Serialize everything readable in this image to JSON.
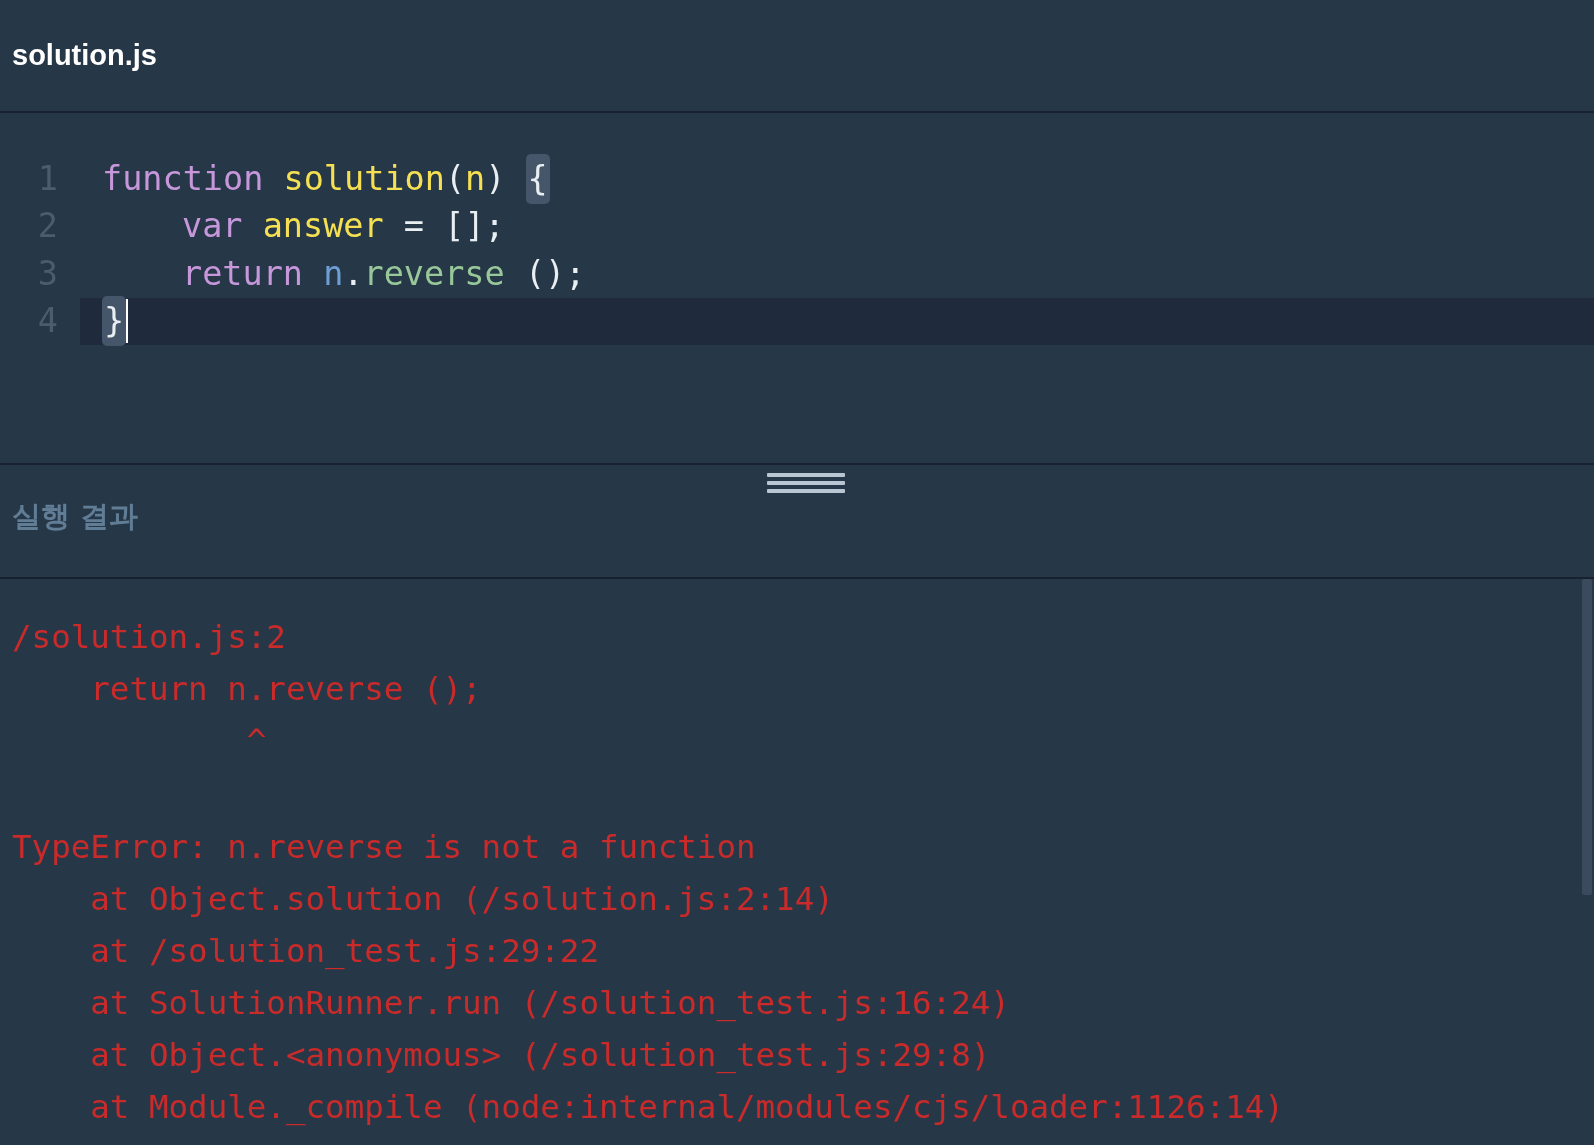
{
  "file_tab": {
    "title": "solution.js"
  },
  "editor": {
    "lines": [
      {
        "number": "1",
        "selected": false,
        "tokens": [
          {
            "kind": "keyword",
            "text": "function"
          },
          {
            "kind": "name",
            "text": " solution"
          },
          {
            "kind": "plain",
            "text": "("
          },
          {
            "kind": "name",
            "text": "n"
          },
          {
            "kind": "plain",
            "text": ") "
          },
          {
            "kind": "brace",
            "text": "{",
            "matched": true
          }
        ]
      },
      {
        "number": "2",
        "selected": false,
        "indented": true,
        "tokens": [
          {
            "kind": "keyword",
            "text": "var"
          },
          {
            "kind": "name",
            "text": " answer"
          },
          {
            "kind": "plain",
            "text": " = [];"
          }
        ]
      },
      {
        "number": "3",
        "selected": false,
        "indented": true,
        "tokens": [
          {
            "kind": "keyword",
            "text": "return"
          },
          {
            "kind": "variable",
            "text": " n"
          },
          {
            "kind": "plain",
            "text": "."
          },
          {
            "kind": "method",
            "text": "reverse"
          },
          {
            "kind": "plain",
            "text": " ();"
          }
        ]
      },
      {
        "number": "4",
        "selected": true,
        "tokens": [
          {
            "kind": "brace",
            "text": "}",
            "matched": true
          }
        ]
      }
    ]
  },
  "results": {
    "title": "실행 결과",
    "output": [
      {
        "text": "/solution.js:2"
      },
      {
        "text": "    return n.reverse ();"
      },
      {
        "text": "            ^"
      },
      {
        "text": "TypeError: n.reverse is not a function",
        "spaced": true
      },
      {
        "text": "    at Object.solution (/solution.js:2:14)"
      },
      {
        "text": "    at /solution_test.js:29:22"
      },
      {
        "text": "    at SolutionRunner.run (/solution_test.js:16:24)"
      },
      {
        "text": "    at Object.<anonymous> (/solution_test.js:29:8)"
      },
      {
        "text": "    at Module._compile (node:internal/modules/cjs/loader:1126:14)"
      }
    ]
  }
}
